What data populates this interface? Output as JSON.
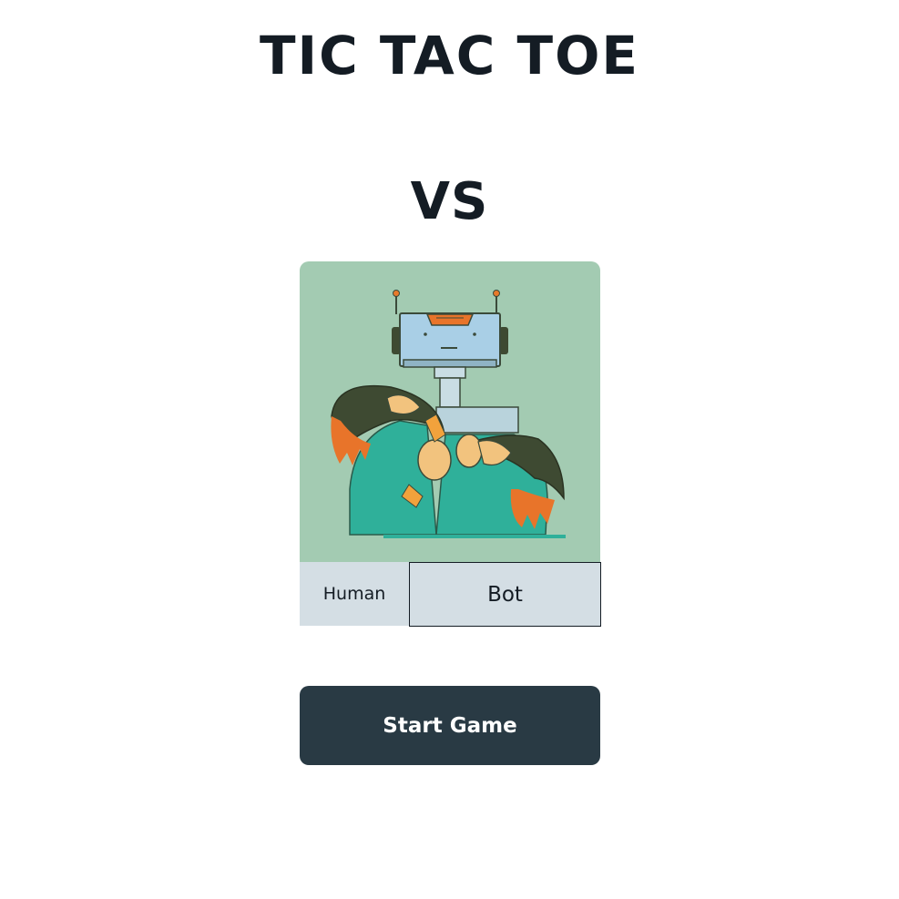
{
  "header": {
    "title": "TIC TAC TOE",
    "versus_label": "VS"
  },
  "opponent_card": {
    "image_icon": "robot-illustration-icon",
    "background_color": "#a3cbb2",
    "options": [
      {
        "id": "human",
        "label": "Human",
        "selected": false
      },
      {
        "id": "bot",
        "label": "Bot",
        "selected": true
      }
    ]
  },
  "actions": {
    "start_label": "Start Game"
  },
  "colors": {
    "text": "#141c24",
    "option_background": "#d4dee4",
    "button_background": "#293a44",
    "button_text": "#ffffff"
  }
}
